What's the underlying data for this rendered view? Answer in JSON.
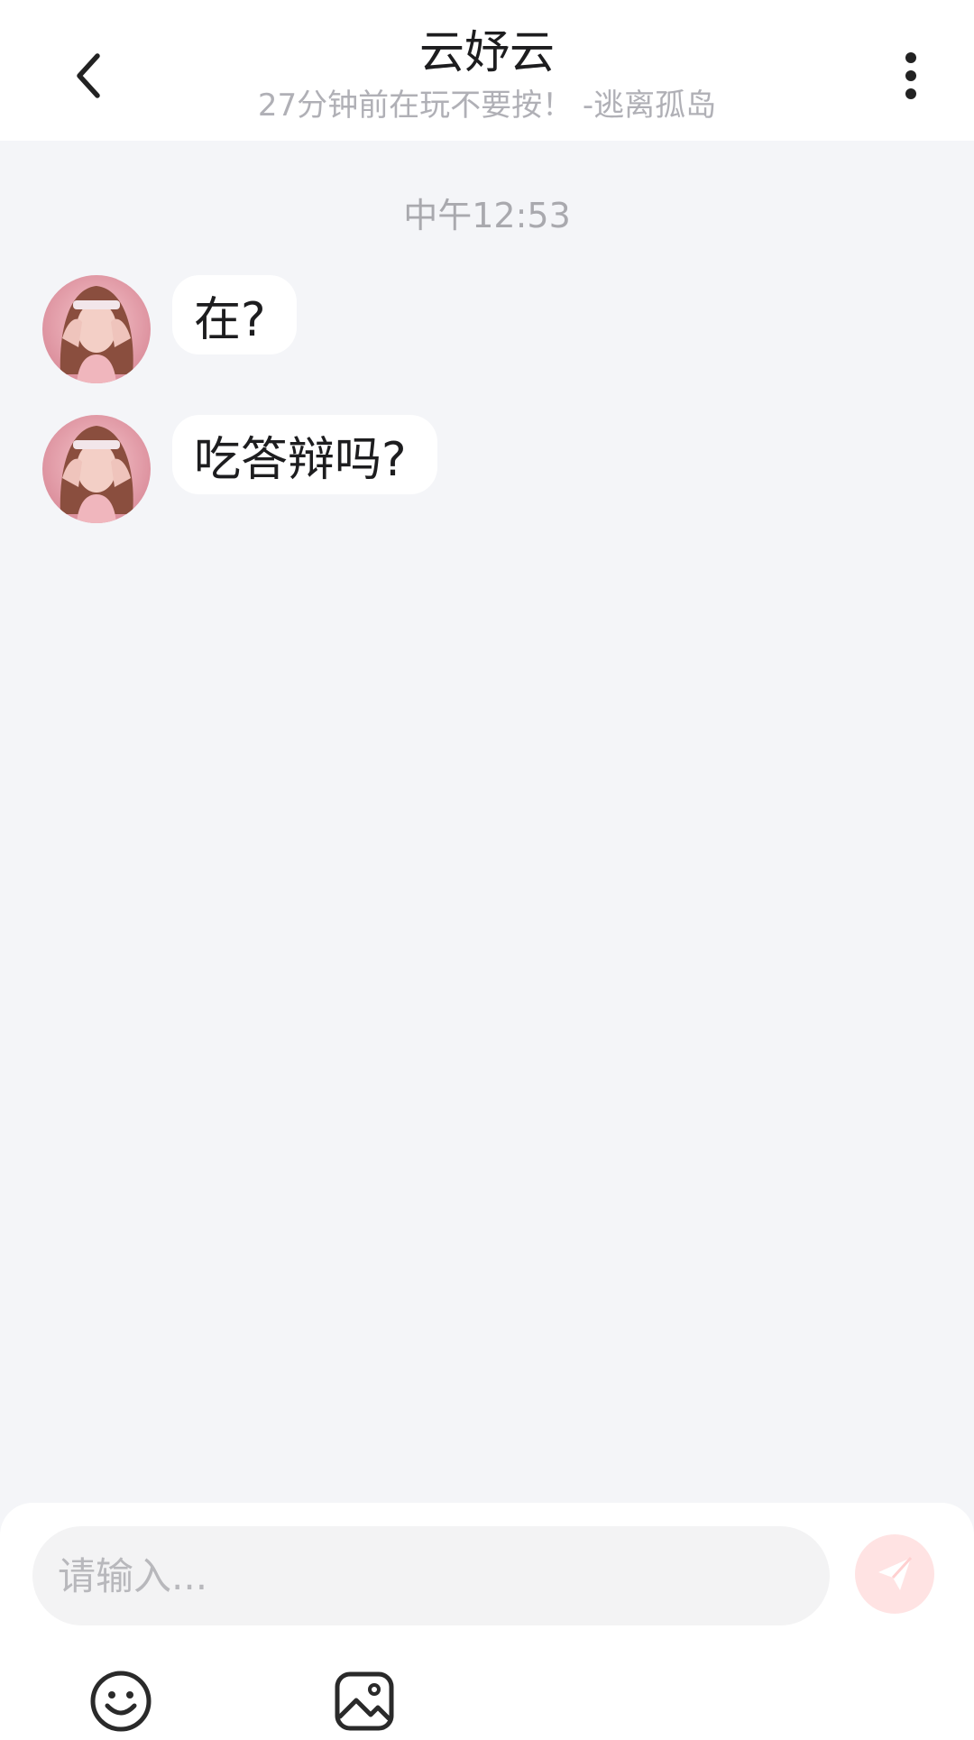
{
  "header": {
    "title": "云妤云",
    "subtitle": "27分钟前在玩不要按！ -逃离孤岛",
    "back_icon": "chevron-left-icon",
    "more_icon": "more-vertical-icon"
  },
  "chat": {
    "timestamp": "中午12:53",
    "messages": [
      {
        "text": "在?",
        "sender": "other"
      },
      {
        "text": "吃答辩吗?",
        "sender": "other"
      }
    ]
  },
  "composer": {
    "placeholder": "请输入...",
    "send_icon": "paper-plane-icon",
    "emoji_icon": "smiley-icon",
    "image_icon": "image-icon"
  },
  "colors": {
    "background": "#f4f5f8",
    "send_button": "#ffe3e3",
    "send_icon": "#ffffff"
  }
}
